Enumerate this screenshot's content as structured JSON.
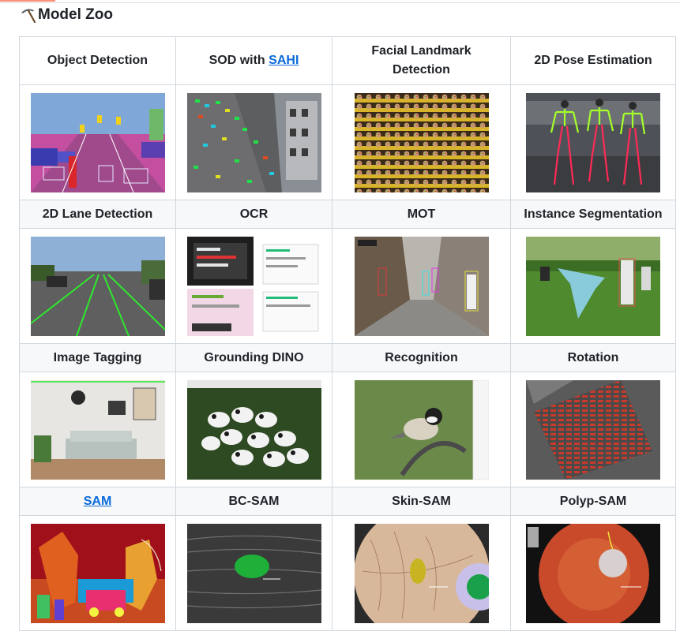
{
  "heading": {
    "icon": "pick-icon",
    "text": "Model Zoo"
  },
  "rows": [
    [
      {
        "label": "Object Detection",
        "image": "object-detection-thumbnail"
      },
      {
        "label_prefix": "SOD with ",
        "link": "SAHI",
        "image": "sod-sahi-thumbnail"
      },
      {
        "label_line1": "Facial Landmark",
        "label_line2": "Detection",
        "image": "facial-landmark-thumbnail"
      },
      {
        "label": "2D Pose Estimation",
        "image": "pose-estimation-thumbnail"
      }
    ],
    [
      {
        "label": "2D Lane Detection",
        "image": "lane-detection-thumbnail"
      },
      {
        "label": "OCR",
        "image": "ocr-thumbnail"
      },
      {
        "label": "MOT",
        "image": "mot-thumbnail"
      },
      {
        "label": "Instance Segmentation",
        "image": "instance-segmentation-thumbnail"
      }
    ],
    [
      {
        "label": "Image Tagging",
        "image": "image-tagging-thumbnail"
      },
      {
        "label": "Grounding DINO",
        "image": "grounding-dino-thumbnail"
      },
      {
        "label": "Recognition",
        "image": "recognition-thumbnail"
      },
      {
        "label": "Rotation",
        "image": "rotation-thumbnail"
      }
    ],
    [
      {
        "link": "SAM",
        "image": "sam-thumbnail"
      },
      {
        "label": "BC-SAM",
        "image": "bc-sam-thumbnail"
      },
      {
        "label": "Skin-SAM",
        "image": "skin-sam-thumbnail"
      },
      {
        "label": "Polyp-SAM",
        "image": "polyp-sam-thumbnail"
      }
    ]
  ],
  "colors": {
    "link": "#0969da",
    "border": "#d0d7de",
    "header_shade": "#f6f8fa"
  }
}
